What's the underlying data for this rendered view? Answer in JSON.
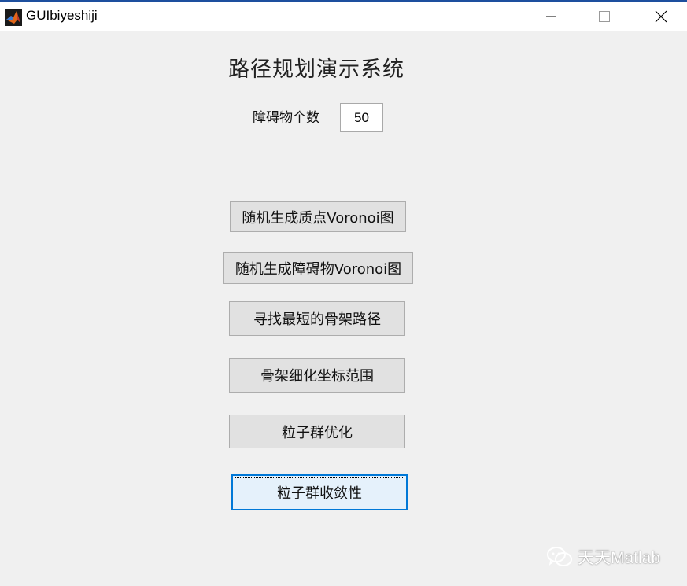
{
  "window": {
    "title": "GUIbiyeshiji",
    "icon": "matlab-logo-icon",
    "minimize_icon": "minimize-icon",
    "maximize_icon": "maximize-icon",
    "close_icon": "close-icon"
  },
  "main": {
    "heading": "路径规划演示系统",
    "obstacle_label": "障碍物个数",
    "obstacle_count": "50",
    "buttons": [
      "随机生成质点Voronoi图",
      "随机生成障碍物Voronoi图",
      "寻找最短的骨架路径",
      "骨架细化坐标范围",
      "粒子群优化",
      "粒子群收敛性"
    ]
  },
  "watermark": {
    "icon": "wechat-icon",
    "text": "天天Matlab"
  },
  "colors": {
    "background": "#f0f0f0",
    "button_face": "#e1e1e1",
    "focus_blue": "#0078d7"
  }
}
